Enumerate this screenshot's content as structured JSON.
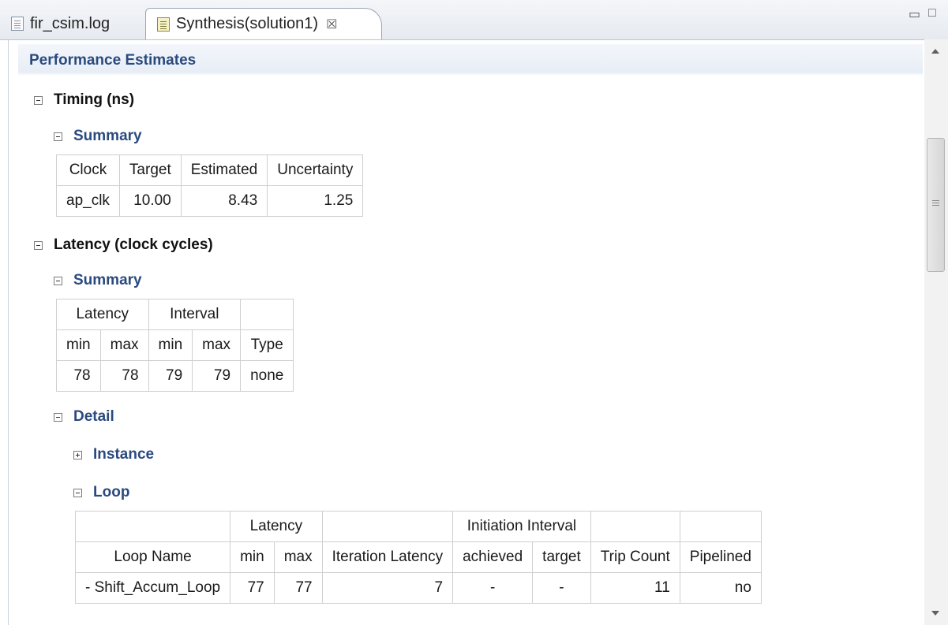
{
  "tabs": [
    {
      "label": "fir_csim.log",
      "icon": "log-file-icon"
    },
    {
      "label": "Synthesis(solution1)",
      "icon": "report-icon",
      "active": true,
      "close": "☒"
    }
  ],
  "window_controls": {
    "minimize": "▭",
    "maximize": "□"
  },
  "report": {
    "title": "Performance Estimates",
    "timing": {
      "header": "Timing (ns)",
      "summary_header": "Summary",
      "columns": [
        "Clock",
        "Target",
        "Estimated",
        "Uncertainty"
      ],
      "row": [
        "ap_clk",
        "10.00",
        "8.43",
        "1.25"
      ]
    },
    "latency": {
      "header": "Latency (clock cycles)",
      "summary_header": "Summary",
      "groups": [
        "Latency",
        "Interval"
      ],
      "columns": [
        "min",
        "max",
        "min",
        "max",
        "Type"
      ],
      "row": [
        "78",
        "78",
        "79",
        "79",
        "none"
      ],
      "detail": {
        "header": "Detail",
        "instance_header": "Instance",
        "loop_header": "Loop",
        "loop_table": {
          "groups": [
            "Latency",
            "Initiation Interval"
          ],
          "columns": [
            "Loop Name",
            "min",
            "max",
            "Iteration Latency",
            "achieved",
            "target",
            "Trip Count",
            "Pipelined"
          ],
          "row": [
            "- Shift_Accum_Loop",
            "77",
            "77",
            "7",
            "-",
            "-",
            "11",
            "no"
          ]
        }
      }
    }
  },
  "colors": {
    "section_blue": "#2a4a7f",
    "tab_bg": "#e6eaf0",
    "grid": "#cfcfcf"
  }
}
